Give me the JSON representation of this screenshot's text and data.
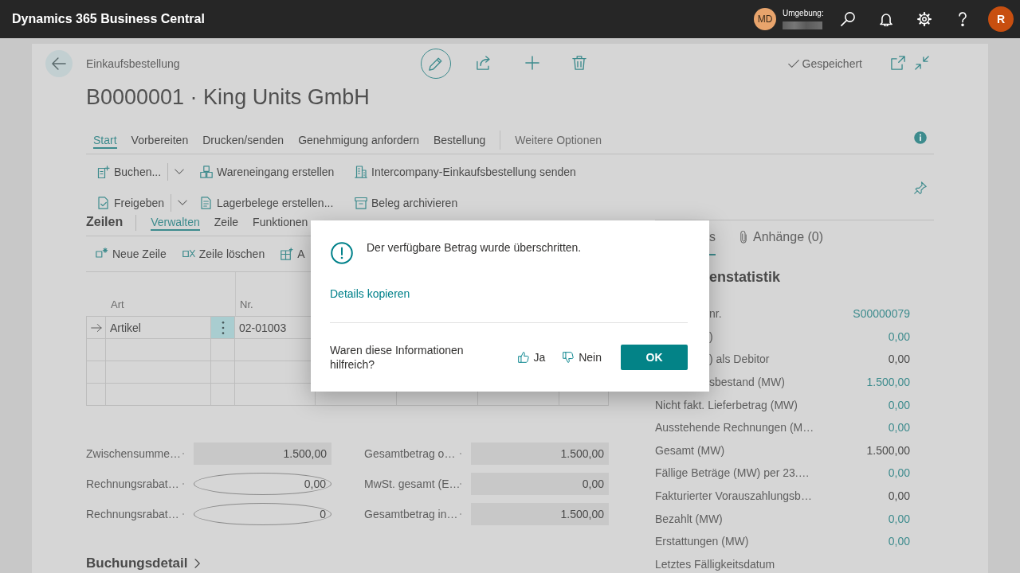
{
  "top_bar": {
    "app_title": "Dynamics 365 Business Central",
    "user_initials": "MD",
    "environment_label": "Umgebung:",
    "account_initial": "R"
  },
  "header": {
    "breadcrumb": "Einkaufsbestellung",
    "title": "B0000001 · King Units GmbH",
    "save_status": "Gespeichert"
  },
  "menu": {
    "tabs": [
      {
        "label": "Start",
        "selected": true
      },
      {
        "label": "Vorbereiten",
        "selected": false
      },
      {
        "label": "Drucken/senden",
        "selected": false
      },
      {
        "label": "Genehmigung anfordern",
        "selected": false
      },
      {
        "label": "Bestellung",
        "selected": false
      }
    ],
    "more": "Weitere Optionen"
  },
  "action_rows": [
    [
      {
        "label": "Buchen...",
        "split": true
      },
      {
        "label": "Wareneingang erstellen",
        "split": false
      },
      {
        "label": "Intercompany-Einkaufsbestellung senden",
        "split": false
      }
    ],
    [
      {
        "label": "Freigeben",
        "split": true
      },
      {
        "label": "Lagerbelege erstellen...",
        "split": false
      },
      {
        "label": "Beleg archivieren",
        "split": false
      }
    ]
  ],
  "lines": {
    "title": "Zeilen",
    "tabs": [
      {
        "label": "Verwalten",
        "selected": true
      },
      {
        "label": "Zeile",
        "selected": false
      },
      {
        "label": "Funktionen",
        "selected": false
      }
    ],
    "actions": [
      "Neue Zeile",
      "Zeile löschen",
      "A"
    ],
    "columns": [
      "Art",
      "Nr."
    ],
    "rows": [
      {
        "current": true,
        "type": "Artikel",
        "number": "02-01003"
      },
      {
        "current": false
      },
      {
        "current": false
      },
      {
        "current": false
      }
    ]
  },
  "totals": {
    "left": [
      {
        "label": "Zwischensumme…",
        "value": "1.500,00",
        "editable": false
      },
      {
        "label": "Rechnungsrabat…",
        "value": "0,00",
        "editable": true
      },
      {
        "label": "Rechnungsrabat…",
        "value": "0",
        "editable": true
      }
    ],
    "right": [
      {
        "label": "Gesamtbetrag o…",
        "value": "1.500,00",
        "editable": false
      },
      {
        "label": "MwSt. gesamt (E…",
        "value": "0,00",
        "editable": false
      },
      {
        "label": "Gesamtbetrag in…",
        "value": "1.500,00",
        "editable": false
      }
    ]
  },
  "posting_details": {
    "title": "Buchungsdetail"
  },
  "factbox": {
    "tabs": [
      {
        "label": "s",
        "selected": true
      },
      {
        "label": "Anhänge (0)",
        "selected": false
      }
    ],
    "heading": "enstatistik",
    "rows": [
      {
        "kind": "covered",
        "label": "nr.",
        "value": "S00000079",
        "drilldown": true
      },
      {
        "kind": "covered",
        "label": ")",
        "value": "0,00",
        "drilldown": true
      },
      {
        "kind": "covered",
        "label": ") als Debitor",
        "value": "0,00",
        "drilldown": false
      },
      {
        "kind": "covered",
        "label": "sbestand (MW)",
        "value": "1.500,00",
        "drilldown": true
      },
      {
        "kind": "full",
        "label": "Nicht fakt. Lieferbetrag (MW)",
        "value": "0,00",
        "drilldown": true
      },
      {
        "kind": "full",
        "label": "Ausstehende Rechnungen (M…",
        "value": "0,00",
        "drilldown": true
      },
      {
        "kind": "full",
        "label": "Gesamt (MW)",
        "value": "1.500,00",
        "drilldown": false
      },
      {
        "kind": "full",
        "label": "Fällige Beträge (MW) per 23.…",
        "value": "0,00",
        "drilldown": true
      },
      {
        "kind": "full",
        "label": "Fakturierter Vorauszahlungsb…",
        "value": "0,00",
        "drilldown": false
      },
      {
        "kind": "full",
        "label": "Bezahlt (MW)",
        "value": "0,00",
        "drilldown": true
      },
      {
        "kind": "full",
        "label": "Erstattungen (MW)",
        "value": "0,00",
        "drilldown": true
      },
      {
        "kind": "full",
        "label": "Letztes Fälligkeitsdatum"
      }
    ]
  },
  "dialog": {
    "message": "Der verfügbare Betrag wurde überschritten.",
    "copy_link": "Details kopieren",
    "feedback_question": "Waren diese Informationen hilfreich?",
    "feedback_yes": "Ja",
    "feedback_no": "Nein",
    "ok_button": "OK"
  }
}
